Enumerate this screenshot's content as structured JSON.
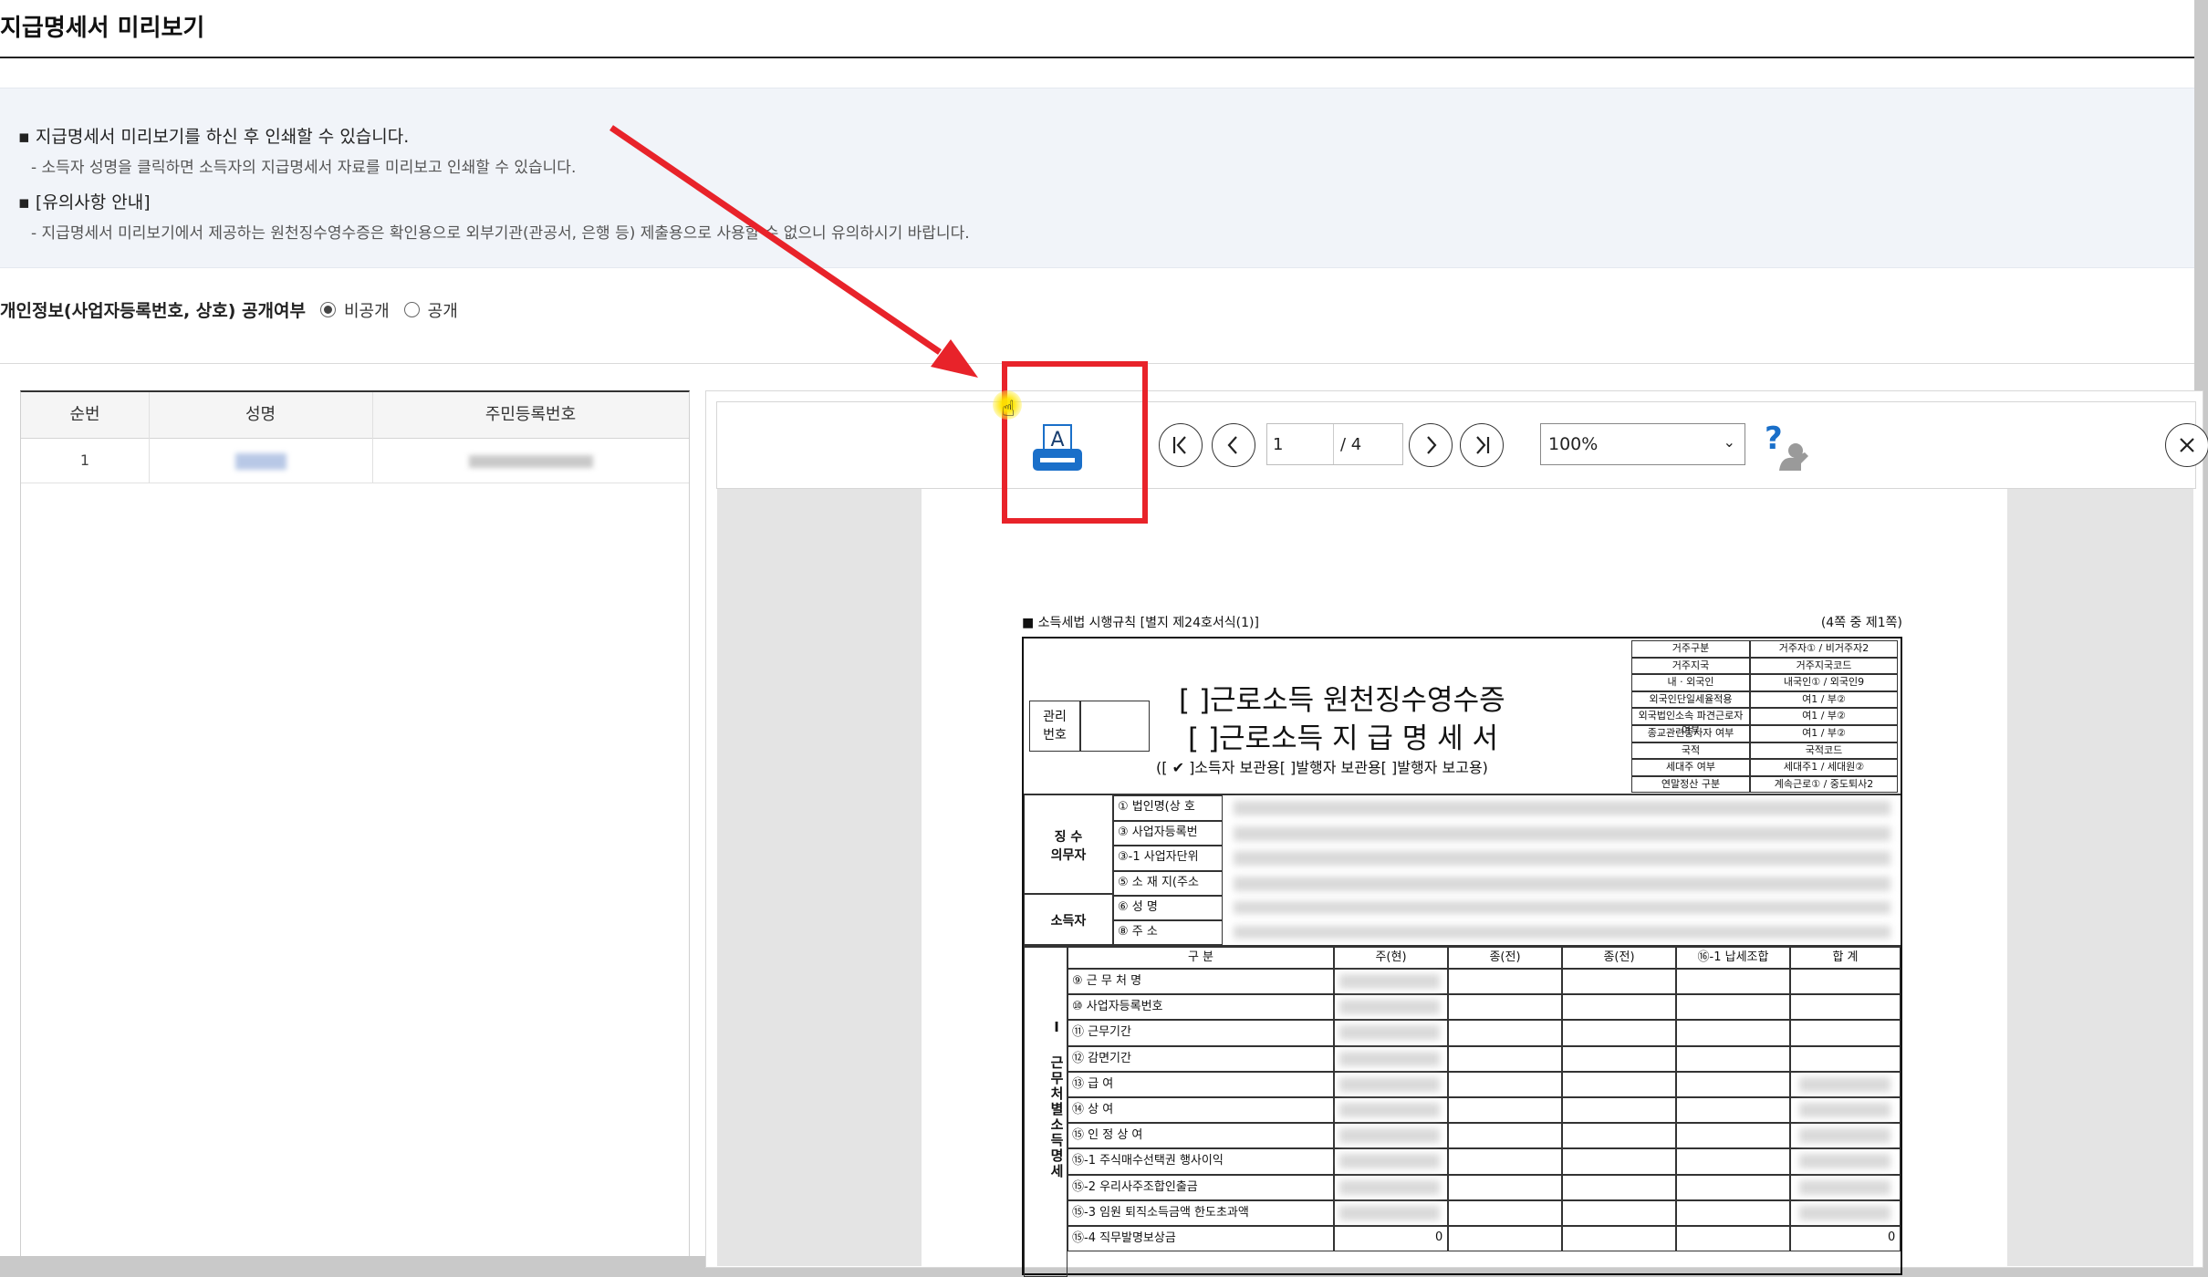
{
  "header": {
    "title": "지급명세서 미리보기"
  },
  "notice": {
    "line1": "지급명세서 미리보기를 하신 후 인쇄할 수 있습니다.",
    "line1_sub": "소득자 성명을 클릭하면 소득자의 지급명세서 자료를 미리보고 인쇄할 수 있습니다.",
    "line2": "[유의사항 안내]",
    "line2_sub": "지급명세서 미리보기에서 제공하는 원천징수영수증은 확인용으로 외부기관(관공서, 은행 등) 제출용으로 사용할 수 없으니 유의하시기 바랍니다."
  },
  "privacy": {
    "label": "개인정보(사업자등록번호, 상호) 공개여부",
    "options": [
      "비공개",
      "공개"
    ],
    "selected": "비공개"
  },
  "table": {
    "columns": [
      "순번",
      "성명",
      "주민등록번호"
    ],
    "rows": [
      {
        "no": "1"
      }
    ]
  },
  "viewer": {
    "current_page": "1",
    "total_pages": "/ 4",
    "zoom": "100%",
    "print_icon_letter": "A",
    "colors": {
      "highlight": "#e8232a",
      "print_icon": "#1a6fc9"
    }
  },
  "document": {
    "rule_ref": "■ 소득세법 시행규칙 [별지 제24호서식(1)]",
    "page_note": "(4쪽 중 제1쪽)",
    "title1": "[  ]근로소득 원천징수영수증",
    "title2": "[  ]근로소득 지 급 명 세 서",
    "subtitle": "([ ✔ ]소득자 보관용[     ]발행자 보관용[     ]발행자 보고용)",
    "mgmt_no": "관리\n번호",
    "right_box": [
      [
        "거주구분",
        "거주자① / 비거주자2"
      ],
      [
        "거주지국",
        "거주지국코드"
      ],
      [
        "내 · 외국인",
        "내국인① / 외국인9"
      ],
      [
        "외국인단일세율적용",
        "여1 / 부②"
      ],
      [
        "외국법인소속 파견근로자 여부",
        "여1 / 부②"
      ],
      [
        "종교관련종사자 여부",
        "여1 / 부②"
      ],
      [
        "국적",
        "국적코드"
      ],
      [
        "세대주 여부",
        "세대주1 / 세대원②"
      ],
      [
        "연말정산 구분",
        "계속근로① / 중도퇴사2"
      ]
    ],
    "payer_label": "징 수\n의무자",
    "payer_rows": [
      "① 법인명(상  호",
      "③ 사업자등록번",
      "③-1 사업자단위",
      "⑤ 소 재 지(주소"
    ],
    "earner_label": "소득자",
    "earner_rows": [
      "⑥ 성        명",
      "⑧ 주        소"
    ],
    "section_label": "Ⅰ 근무처별소득명세",
    "grid_headers": [
      "구  분",
      "주(현)",
      "종(전)",
      "종(전)",
      "⑯-1 납세조합",
      "합  계"
    ],
    "grid_rows": [
      "⑨ 근  무  처  명",
      "⑩ 사업자등록번호",
      "⑪ 근무기간",
      "⑫ 감면기간",
      "⑬ 급          여",
      "⑭ 상          여",
      "⑮ 인  정  상  여",
      "⑮-1 주식매수선택권 행사이익",
      "⑮-2 우리사주조합인출금",
      "⑮-3 임원 퇴직소득금액 한도초과액",
      "⑮-4 직무발명보상금"
    ],
    "last_row_values": [
      "0",
      "0"
    ]
  }
}
